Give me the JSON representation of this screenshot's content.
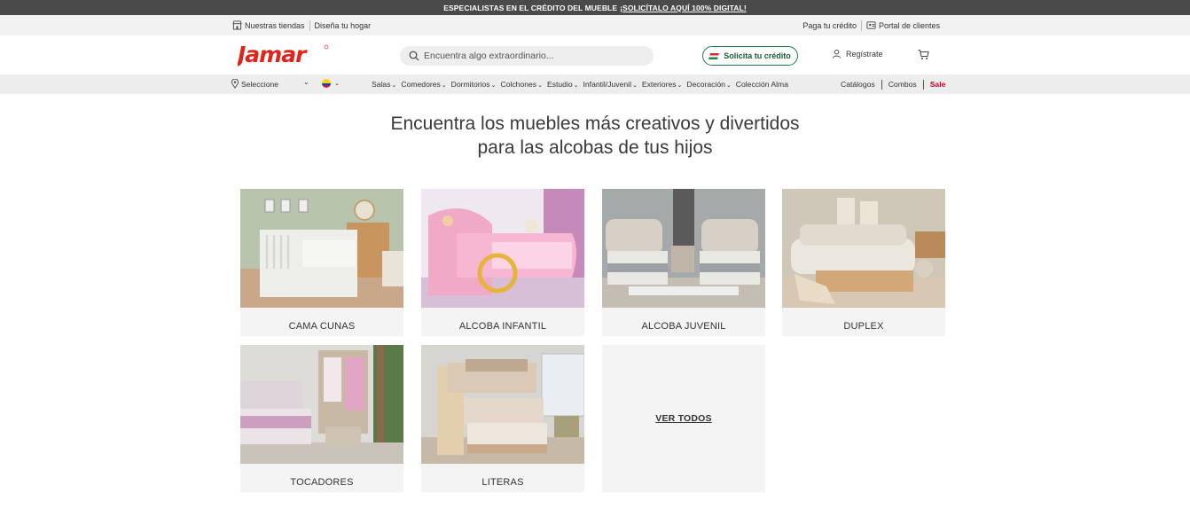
{
  "promo": {
    "text": "ESPECIALISTAS EN EL CRÉDITO DEL MUEBLE",
    "link": "¡SOLICÍTALO AQUÍ 100% DIGITAL!"
  },
  "utility": {
    "stores": "Nuestras tiendas",
    "design": "Diseña tu hogar",
    "pay": "Paga tu crédito",
    "portal": "Portal de clientes"
  },
  "header": {
    "logo_text": "Jamar",
    "search_placeholder": "Encuentra algo extraordinario...",
    "credit_button": "Solicita tu crédito",
    "register": "Regístrate"
  },
  "nav": {
    "location": "Seleccione",
    "menu": [
      {
        "label": "Salas"
      },
      {
        "label": "Comedores"
      },
      {
        "label": "Dormitorios"
      },
      {
        "label": "Colchones"
      },
      {
        "label": "Estudio"
      },
      {
        "label": "Infantil/Juvenil"
      },
      {
        "label": "Exteriores"
      },
      {
        "label": "Decoración"
      }
    ],
    "collection": "Colección Alma",
    "catalogs": "Catálogos",
    "combos": "Combos",
    "sale": "Sale"
  },
  "main": {
    "headline_line1": "Encuentra los muebles más creativos y divertidos",
    "headline_line2": "para las alcobas de tus hijos",
    "cards": [
      {
        "label": "CAMA CUNAS"
      },
      {
        "label": "ALCOBA INFANTIL"
      },
      {
        "label": "ALCOBA JUVENIL"
      },
      {
        "label": "DUPLEX"
      },
      {
        "label": "TOCADORES"
      },
      {
        "label": "LITERAS"
      }
    ],
    "see_all": "VER TODOS"
  },
  "colors": {
    "brand_red": "#e2231a",
    "credit_green": "#1a7a45",
    "sale_red": "#d0021b"
  }
}
